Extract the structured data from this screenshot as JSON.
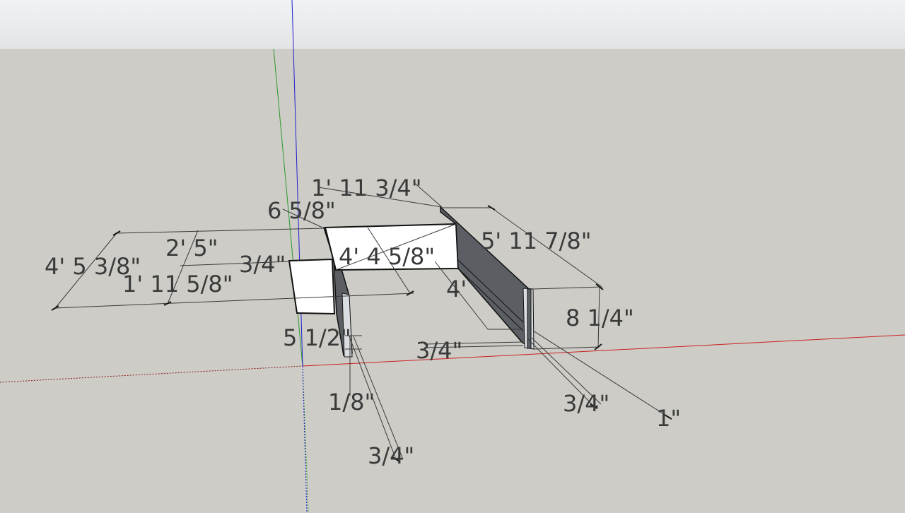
{
  "app": "SketchUp model viewport",
  "colors": {
    "sky": "#eaebec",
    "ground": "#cdccc7",
    "red_axis": "#cc2020",
    "green_axis": "#2a9a2a",
    "blue_axis": "#2020cc",
    "panel_front": "#ffffff",
    "panel_back": "#5d6166",
    "dimension": "#3a3a3a"
  },
  "dimensions": {
    "d_1_11_3_4": "1' 11 3/4\"",
    "d_6_5_8": "6 5/8\"",
    "d_5_11_7_8": "5' 11 7/8\"",
    "d_2_5": "2' 5\"",
    "d_4_5_3_8": "4' 5 3/8\"",
    "d_3_4_left": "3/4\"",
    "d_4_4_5_8": "4' 4 5/8\"",
    "d_1_11_5_8": "1' 11 5/8\"",
    "d_4": "4'",
    "d_8_1_4": "8 1/4\"",
    "d_5_1_2": "5 1/2\"",
    "d_3_4_mid": "3/4\"",
    "d_1_8": "1/8\"",
    "d_3_4_right": "3/4\"",
    "d_1": "1\"",
    "d_3_4_bottom": "3/4\""
  }
}
